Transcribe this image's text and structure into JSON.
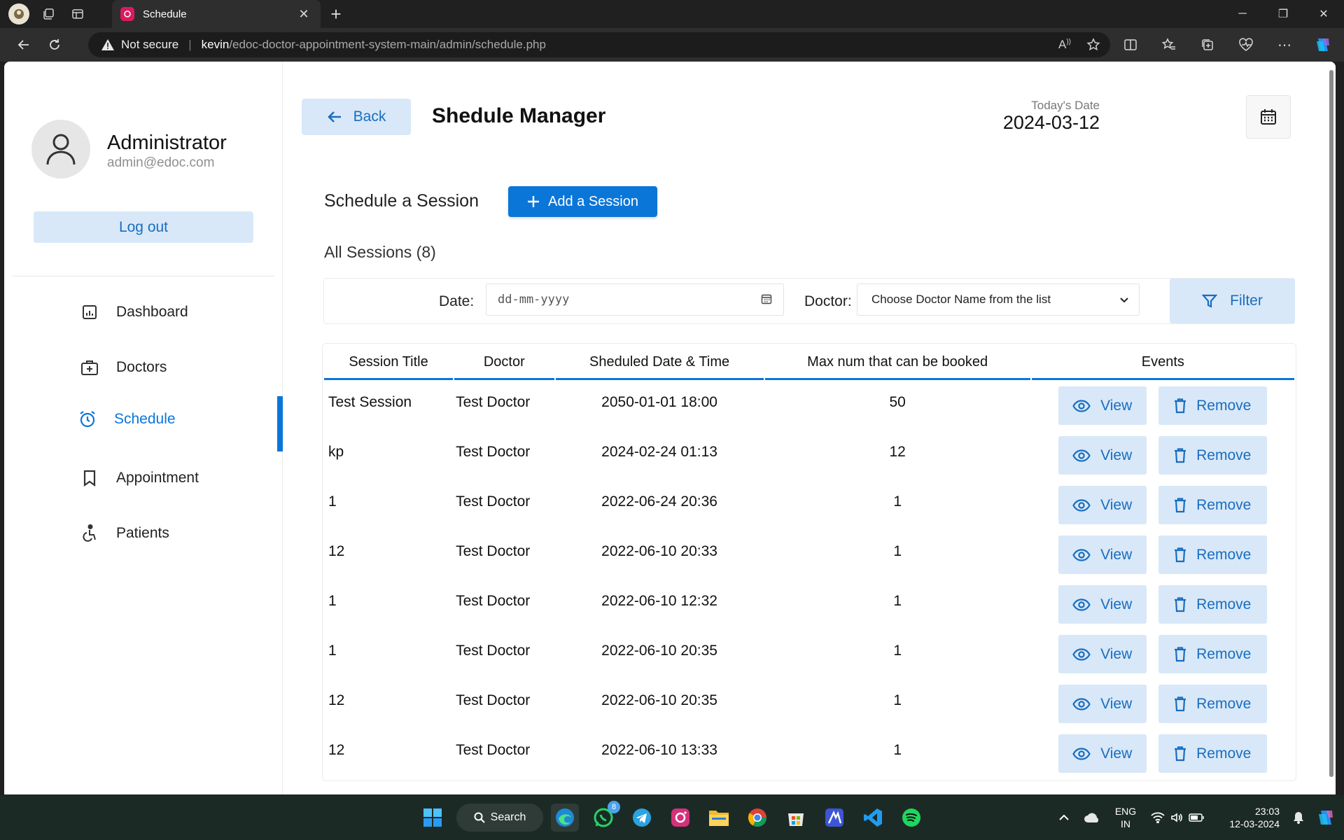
{
  "browser": {
    "tab_title": "Schedule",
    "not_secure": "Not secure",
    "url_host": "kevin",
    "url_path": "/edoc-doctor-appointment-system-main/admin/schedule.php"
  },
  "sidebar": {
    "admin_name": "Administrator",
    "admin_email": "admin@edoc.com",
    "logout_label": "Log out",
    "items": [
      {
        "label": "Dashboard",
        "icon": "dashboard-icon"
      },
      {
        "label": "Doctors",
        "icon": "doctor-bag-icon"
      },
      {
        "label": "Schedule",
        "icon": "alarm-clock-icon",
        "active": true
      },
      {
        "label": "Appointment",
        "icon": "bookmark-icon"
      },
      {
        "label": "Patients",
        "icon": "wheelchair-icon"
      }
    ]
  },
  "header": {
    "back_label": "Back",
    "title": "Shedule Manager",
    "today_label": "Today's Date",
    "today_value": "2024-03-12"
  },
  "main": {
    "schedule_label": "Schedule a Session",
    "add_label": "Add a Session",
    "all_sessions": "All Sessions (8)"
  },
  "filter": {
    "date_label": "Date:",
    "date_placeholder": "dd-mm-yyyy",
    "doctor_label": "Doctor:",
    "doctor_placeholder": "Choose Doctor Name from the list",
    "filter_label": "Filter"
  },
  "table": {
    "headers": [
      "Session Title",
      "Doctor",
      "Sheduled Date & Time",
      "Max num that can be booked",
      "Events"
    ],
    "view_label": "View",
    "remove_label": "Remove",
    "rows": [
      {
        "title": "Test Session",
        "doctor": "Test Doctor",
        "datetime": "2050-01-01 18:00",
        "max": "50"
      },
      {
        "title": "kp",
        "doctor": "Test Doctor",
        "datetime": "2024-02-24 01:13",
        "max": "12"
      },
      {
        "title": "1",
        "doctor": "Test Doctor",
        "datetime": "2022-06-24 20:36",
        "max": "1"
      },
      {
        "title": "12",
        "doctor": "Test Doctor",
        "datetime": "2022-06-10 20:33",
        "max": "1"
      },
      {
        "title": "1",
        "doctor": "Test Doctor",
        "datetime": "2022-06-10 12:32",
        "max": "1"
      },
      {
        "title": "1",
        "doctor": "Test Doctor",
        "datetime": "2022-06-10 20:35",
        "max": "1"
      },
      {
        "title": "12",
        "doctor": "Test Doctor",
        "datetime": "2022-06-10 20:35",
        "max": "1"
      },
      {
        "title": "12",
        "doctor": "Test Doctor",
        "datetime": "2022-06-10 13:33",
        "max": "1"
      }
    ]
  },
  "taskbar": {
    "search_label": "Search",
    "whatsapp_badge": "8",
    "lang_line1": "ENG",
    "lang_line2": "IN",
    "time": "23:03",
    "date": "12-03-2024"
  },
  "colors": {
    "accent": "#0a76d8",
    "soft_button": "#d8e8f8",
    "soft_button_text": "#1a6dbf"
  }
}
